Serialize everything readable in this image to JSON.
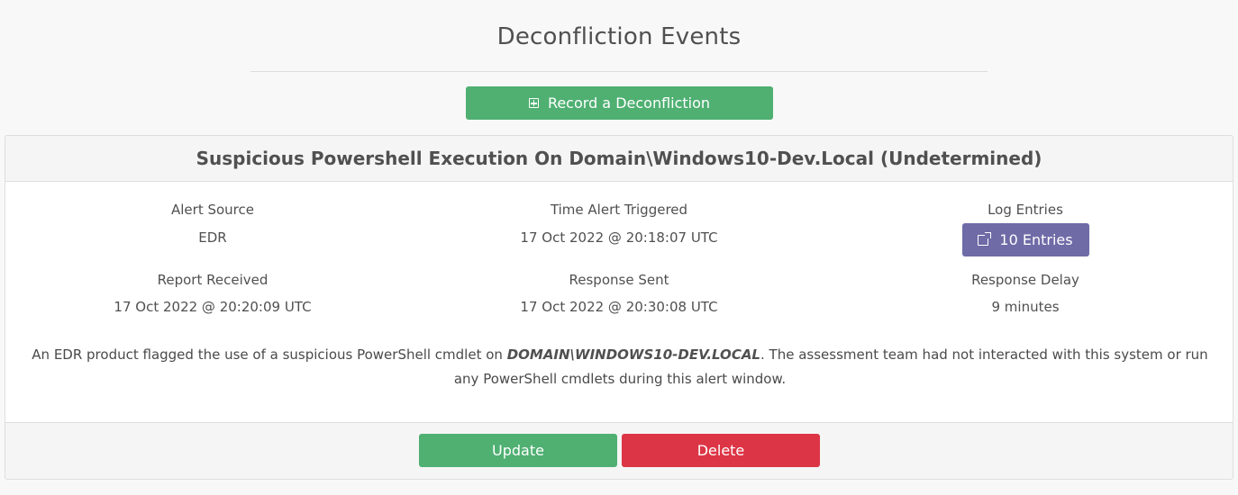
{
  "page": {
    "title": "Deconfliction Events"
  },
  "toolbar": {
    "record_label": "Record a Deconfliction"
  },
  "event": {
    "title": "Suspicious Powershell Execution On Domain\\Windows10-Dev.Local (Undetermined)",
    "fields": {
      "alert_source": {
        "label": "Alert Source",
        "value": "EDR"
      },
      "time_alert_triggered": {
        "label": "Time Alert Triggered",
        "value": "17 Oct 2022 @ 20:18:07 UTC"
      },
      "log_entries": {
        "label": "Log Entries",
        "button_label": "10 Entries"
      },
      "report_received": {
        "label": "Report Received",
        "value": "17 Oct 2022 @ 20:20:09 UTC"
      },
      "response_sent": {
        "label": "Response Sent",
        "value": "17 Oct 2022 @ 20:30:08 UTC"
      },
      "response_delay": {
        "label": "Response Delay",
        "value": "9 minutes"
      }
    },
    "description": {
      "before": "An EDR product flagged the use of a suspicious PowerShell cmdlet on ",
      "host": "DOMAIN\\WINDOWS10-DEV.LOCAL",
      "after": ". The assessment team had not interacted with this system or run any PowerShell cmdlets during this alert window."
    },
    "actions": {
      "update_label": "Update",
      "delete_label": "Delete"
    }
  },
  "colors": {
    "success": "#4fb072",
    "danger": "#dc3545",
    "secondary": "#6f6ba7"
  },
  "icons": {
    "record": "plus-square-icon",
    "entries": "external-link-icon"
  }
}
